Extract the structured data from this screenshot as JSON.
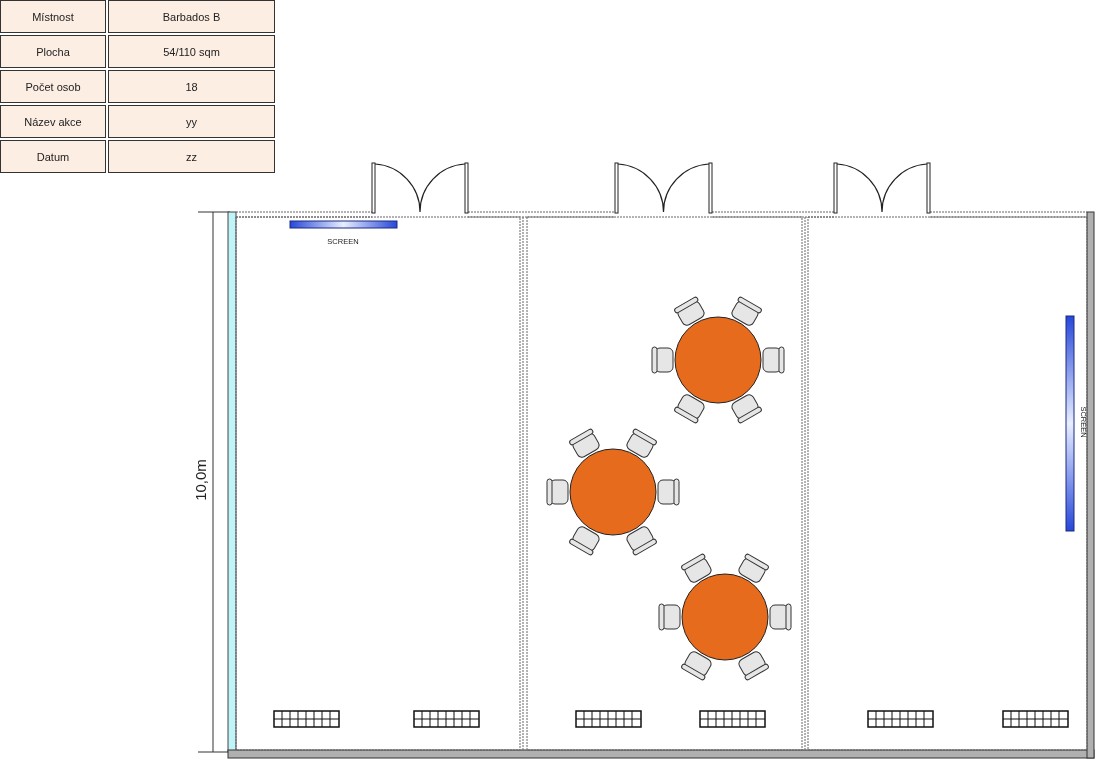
{
  "info_table": {
    "rows": [
      {
        "label": "Místnost",
        "value": "Barbados B"
      },
      {
        "label": "Plocha",
        "value": "54/110 sqm"
      },
      {
        "label": "Počet osob",
        "value": "18"
      },
      {
        "label": "Název akce",
        "value": "yy"
      },
      {
        "label": "Datum",
        "value": "zz"
      }
    ]
  },
  "floor_plan": {
    "dimension": "10,0m",
    "screens": [
      {
        "label": "SCREEN"
      },
      {
        "label": "SCREEN"
      }
    ]
  }
}
